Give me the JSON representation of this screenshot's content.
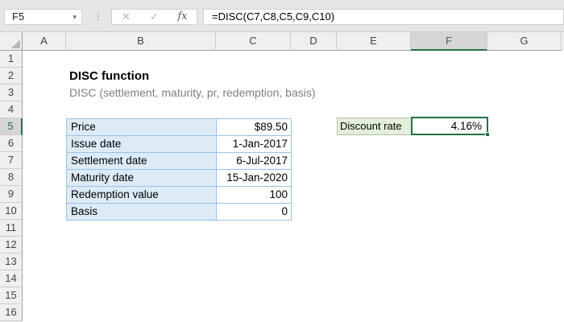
{
  "name_box": {
    "value": "F5"
  },
  "formula_bar": {
    "formula": "=DISC(C7,C8,C5,C9,C10)",
    "icons": {
      "cancel": "✕",
      "enter": "✓",
      "fx": "fx",
      "dropdown": "▾",
      "dots": "⋮"
    }
  },
  "grid": {
    "column_headers": [
      "A",
      "B",
      "C",
      "D",
      "E",
      "F",
      "G"
    ],
    "row_headers": [
      "1",
      "2",
      "3",
      "4",
      "5",
      "6",
      "7",
      "8",
      "9",
      "10",
      "11",
      "12",
      "13",
      "14",
      "15",
      "16"
    ],
    "selected_cell": "F5",
    "selected_column": "F",
    "selected_row": "5"
  },
  "sheet": {
    "title": "DISC function",
    "subtitle": "DISC (settlement, maturity, pr, redemption, basis)",
    "table": {
      "rows": [
        {
          "label": "Price",
          "value": "$89.50"
        },
        {
          "label": "Issue date",
          "value": "1-Jan-2017"
        },
        {
          "label": "Settlement date",
          "value": "6-Jul-2017"
        },
        {
          "label": "Maturity date",
          "value": "15-Jan-2020"
        },
        {
          "label": "Redemption value",
          "value": "100"
        },
        {
          "label": "Basis",
          "value": "0"
        }
      ]
    },
    "result_label": "Discount rate",
    "result_value": "4.16%"
  },
  "colors": {
    "accent_green": "#217346",
    "label_fill": "#ddebf7",
    "label_border": "#9bc2e6",
    "result_fill": "#e2efda",
    "chrome_bg": "#e6e6e6",
    "header_bg": "#efefef",
    "header_selected_bg": "#d6d6d6"
  }
}
